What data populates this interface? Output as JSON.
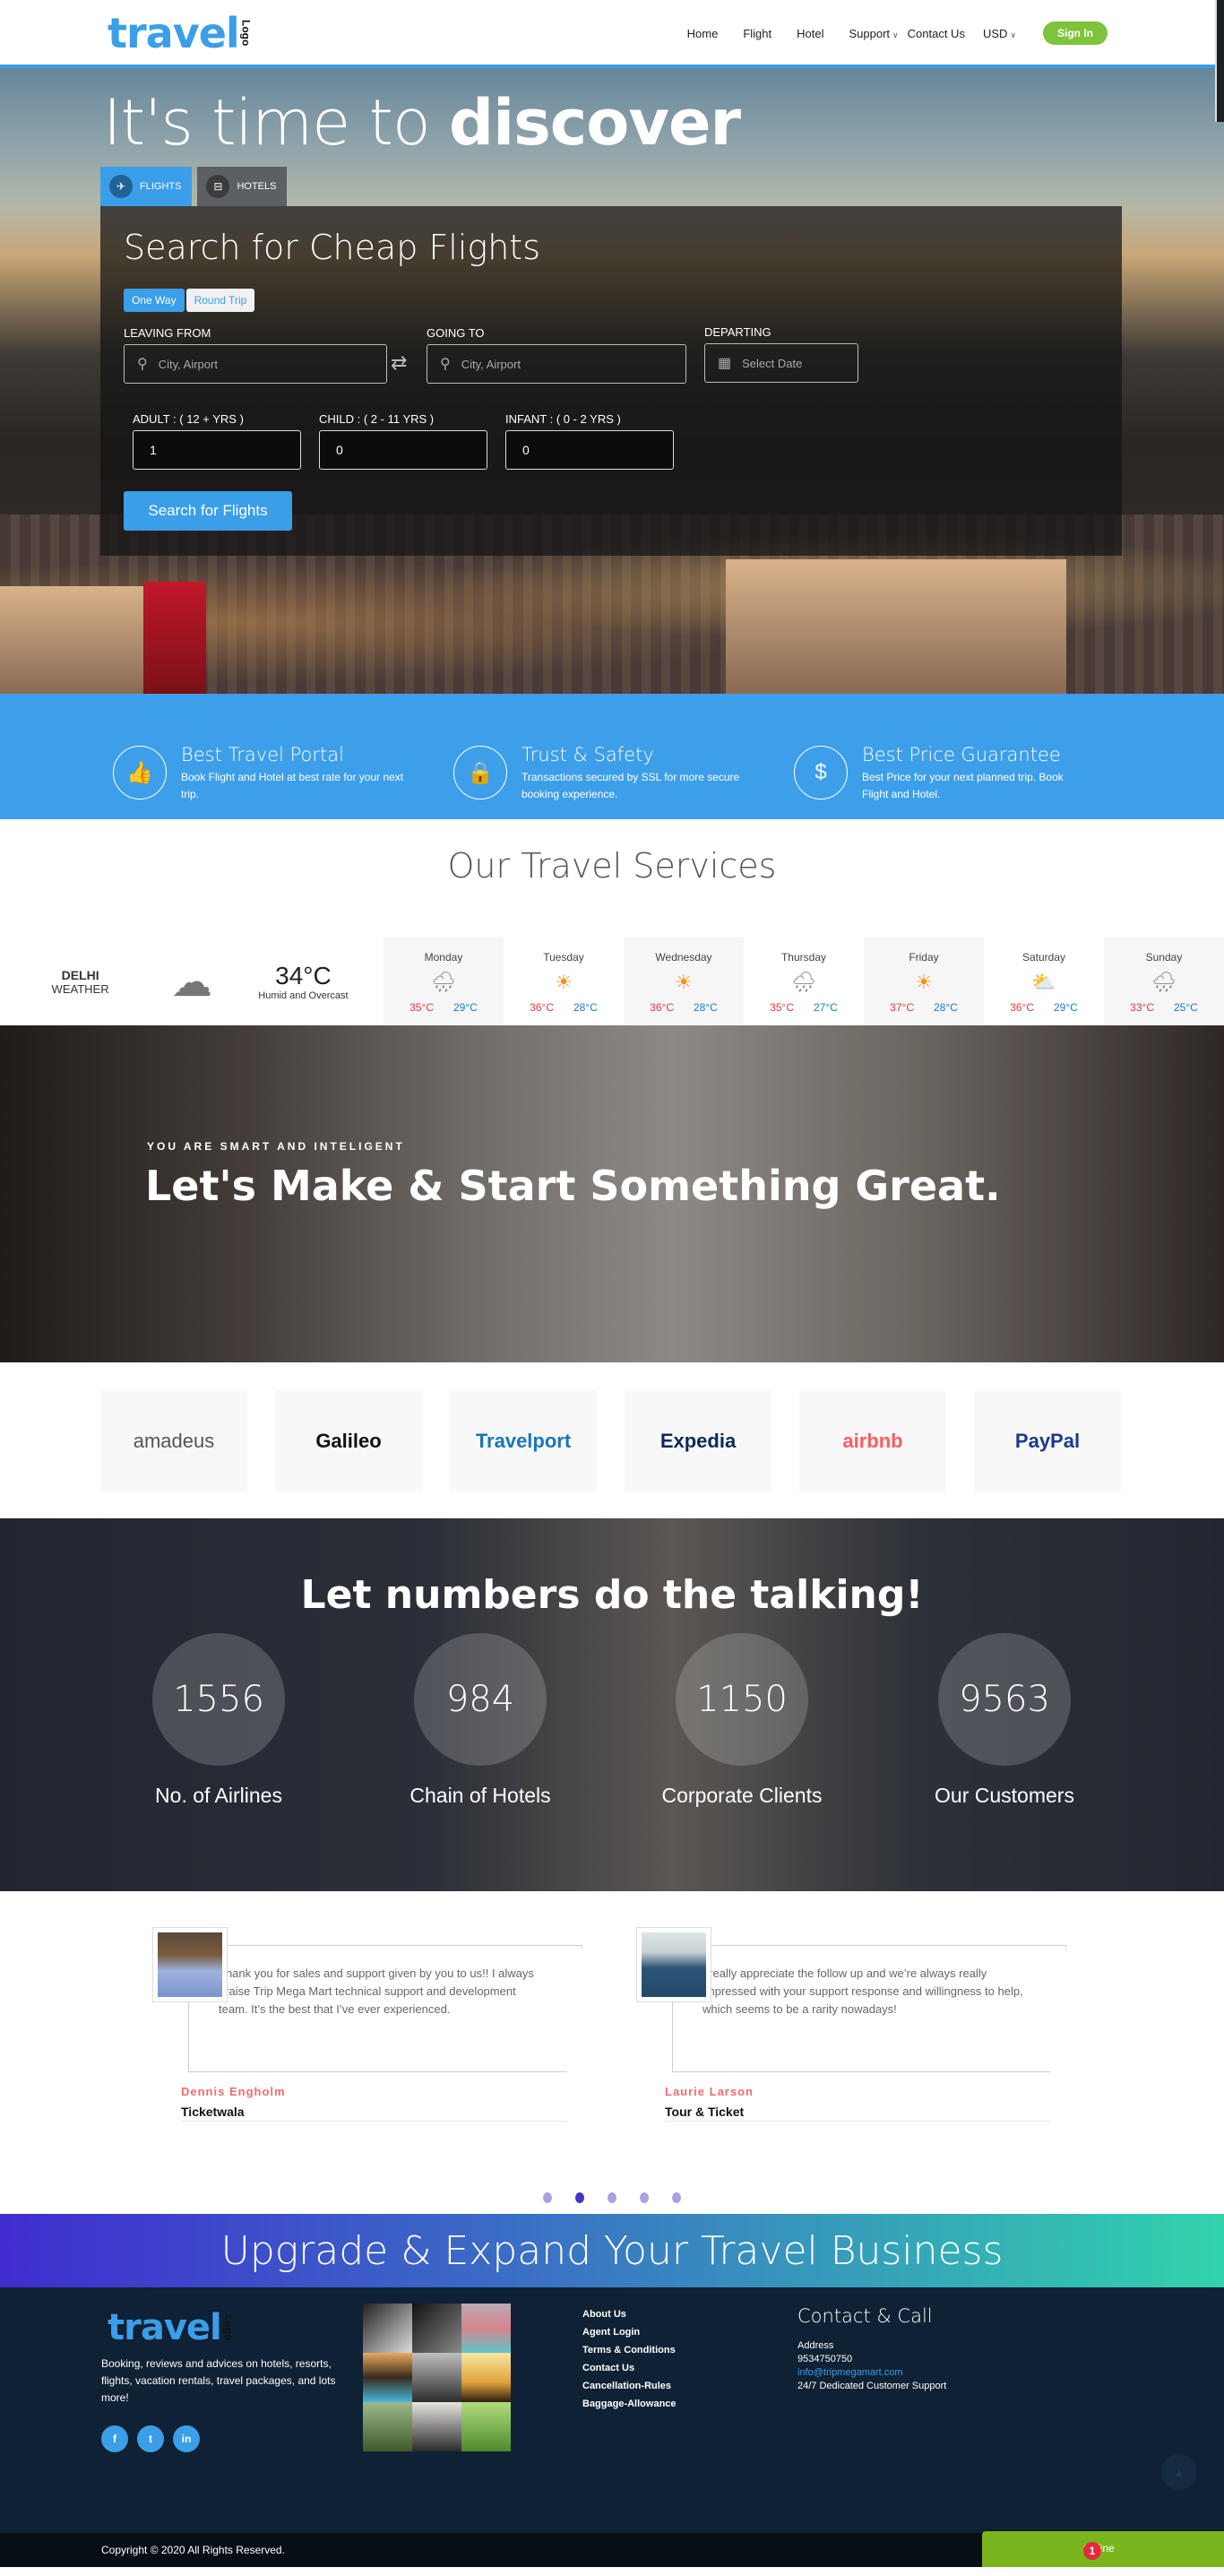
{
  "header": {
    "logo_word": "travel",
    "logo_tag": "Logo",
    "nav": [
      "Home",
      "Flight",
      "Hotel",
      "Support",
      "Contact Us",
      "USD"
    ],
    "signin_label": "Sign In"
  },
  "hero": {
    "title_light": "It's time to",
    "title_bold": "discover",
    "tabs": [
      {
        "label": "FLIGHTS",
        "icon": "plane-icon",
        "active": true
      },
      {
        "label": "HOTELS",
        "icon": "bed-icon",
        "active": false
      }
    ],
    "search": {
      "title": "Search for Cheap Flights",
      "trip_types": [
        "One Way",
        "Round Trip"
      ],
      "selected_trip": "One Way",
      "leaving_label": "LEAVING FROM",
      "leaving_placeholder": "City, Airport",
      "going_label": "GOING TO",
      "going_placeholder": "City, Airport",
      "departing_label": "DEPARTING",
      "departing_placeholder": "Select Date",
      "adult_label": "ADULT : ( 12 + YRS )",
      "adult_value": "1",
      "child_label": "CHILD : ( 2 - 11 YRS )",
      "child_value": "0",
      "infant_label": "INFANT : ( 0 - 2 YRS )",
      "infant_value": "0",
      "button_label": "Search for Flights"
    }
  },
  "features": [
    {
      "title": "Best Travel Portal",
      "text": "Book Flight and Hotel at best rate for your next trip.",
      "icon": "thumbs-up-icon",
      "glyph": "👍"
    },
    {
      "title": "Trust & Safety",
      "text": "Transactions secured by SSL for more secure booking experience.",
      "icon": "lock-icon",
      "glyph": "🔒"
    },
    {
      "title": "Best Price Guarantee",
      "text": "Best Price for your next planned trip. Book Flight and Hotel.",
      "icon": "dollar-icon",
      "glyph": "$"
    }
  ],
  "services_title": "Our Travel Services",
  "weather": {
    "city": "DELHI",
    "label": "WEATHER",
    "current_temp": "34°C",
    "condition": "Humid and Overcast",
    "days": [
      {
        "day": "Monday",
        "icon": "rain-cloud-icon",
        "glyph": "🌧",
        "hi": "35°C",
        "lo": "29°C"
      },
      {
        "day": "Tuesday",
        "icon": "sun-icon",
        "glyph": "☀",
        "hi": "36°C",
        "lo": "28°C"
      },
      {
        "day": "Wednesday",
        "icon": "sun-icon",
        "glyph": "☀",
        "hi": "36°C",
        "lo": "28°C"
      },
      {
        "day": "Thursday",
        "icon": "rain-cloud-icon",
        "glyph": "🌧",
        "hi": "35°C",
        "lo": "27°C"
      },
      {
        "day": "Friday",
        "icon": "sun-icon",
        "glyph": "☀",
        "hi": "37°C",
        "lo": "28°C"
      },
      {
        "day": "Saturday",
        "icon": "partly-cloudy-icon",
        "glyph": "⛅",
        "hi": "36°C",
        "lo": "29°C"
      },
      {
        "day": "Sunday",
        "icon": "rain-cloud-icon",
        "glyph": "🌧",
        "hi": "33°C",
        "lo": "25°C"
      }
    ]
  },
  "promo": {
    "subtitle": "YOU ARE SMART AND INTELIGENT",
    "title": "Let's Make & Start Something Great."
  },
  "partners": [
    {
      "name": "amadeus",
      "color": "#555555"
    },
    {
      "name": "Galileo",
      "color": "#111111"
    },
    {
      "name": "Travelport",
      "color": "#1b75bb"
    },
    {
      "name": "Expedia",
      "color": "#0b2a57"
    },
    {
      "name": "airbnb",
      "color": "#ff5a5f"
    },
    {
      "name": "PayPal",
      "color": "#1a3b8c"
    }
  ],
  "stats": {
    "title": "Let numbers do the talking!",
    "items": [
      {
        "value": "1556",
        "label": "No. of Airlines"
      },
      {
        "value": "984",
        "label": "Chain of Hotels"
      },
      {
        "value": "1150",
        "label": "Corporate Clients"
      },
      {
        "value": "9563",
        "label": "Our Customers"
      }
    ]
  },
  "testimonials": [
    {
      "quote": "Thank you for sales and support given by you to us!! I always praise Trip Mega Mart technical support and development team. It’s the best that I’ve ever experienced.",
      "name": "Dennis Engholm",
      "company": "Ticketwala"
    },
    {
      "quote": "I really appreciate the follow up and we’re always really impressed with your support response and willingness to help, which seems to be a rarity nowadays!",
      "name": "Laurie Larson",
      "company": "Tour & Ticket"
    }
  ],
  "carousel": {
    "count": 5,
    "active_index": 1
  },
  "upgrade_title": "Upgrade & Expand Your Travel Business",
  "footer": {
    "description": "Booking, reviews and advices on hotels, resorts, flights, vacation rentals, travel packages, and lots more!",
    "socials": [
      {
        "icon": "facebook-icon",
        "glyph": "f"
      },
      {
        "icon": "twitter-icon",
        "glyph": "t"
      },
      {
        "icon": "linkedin-icon",
        "glyph": "in"
      }
    ],
    "links": [
      "About Us",
      "Agent Login",
      "Terms & Conditions",
      "Contact Us",
      "Cancellation-Rules",
      "Baggage-Allowance"
    ],
    "contact_title": "Contact & Call",
    "address_label": "Address",
    "phone": "9534750750",
    "email": "info@tripmegamart.com",
    "support": "24/7 Dedicated Customer Support",
    "copyright": "Copyright © 2020 All Rights Reserved."
  },
  "chat": {
    "label": "Online",
    "badge": "1"
  },
  "colors": {
    "accent": "#3b9ee8",
    "signin": "#7dc33b",
    "footer_bg": "#0f2134",
    "chat": "#7ab51d",
    "name_red": "#f26b6b"
  }
}
